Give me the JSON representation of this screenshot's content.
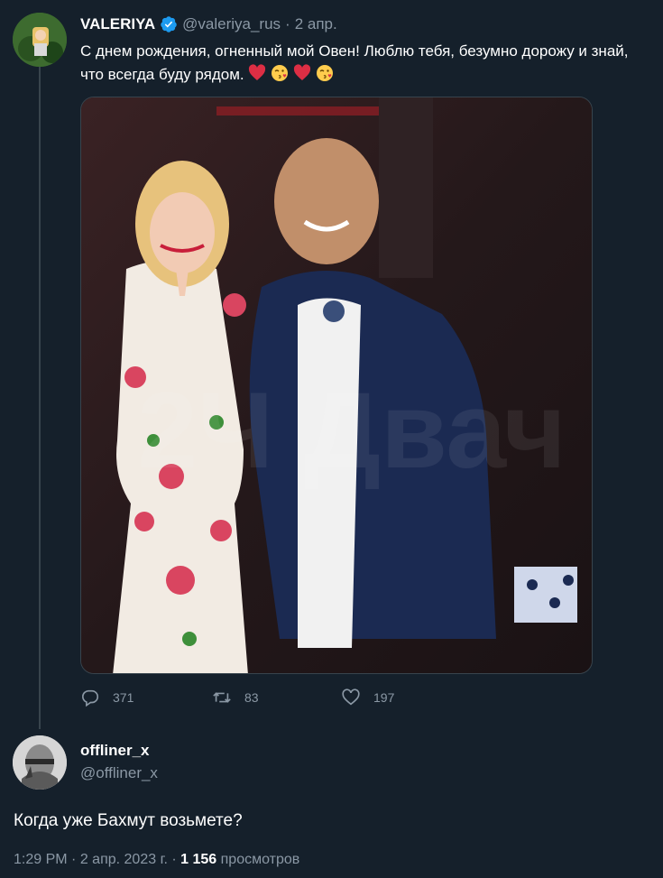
{
  "tweet": {
    "display_name": "VALERIYA",
    "handle": "@valeriya_rus",
    "separator": "·",
    "date": "2 апр.",
    "text": "С днем рождения, огненный мой Овен! Люблю тебя, безумно дорожу и знай, что всегда буду рядом.",
    "emojis": [
      "red-heart",
      "kissing-face",
      "red-heart",
      "kissing-face"
    ],
    "watermark": "2Ч Двач",
    "stats": {
      "replies": "371",
      "retweets": "83",
      "likes": "197"
    }
  },
  "reply": {
    "display_name": "offliner_x",
    "handle": "@offliner_x",
    "text": "Когда уже Бахмут возьмете?",
    "time": "1:29 PM",
    "separator": "·",
    "date": "2 апр. 2023 г.",
    "separator2": "·",
    "views_count": "1 156",
    "views_label": "просмотров"
  },
  "colors": {
    "background": "#15202b",
    "secondary_text": "#8b98a5",
    "verified": "#1d9bf0",
    "heart": "#e0245e"
  }
}
